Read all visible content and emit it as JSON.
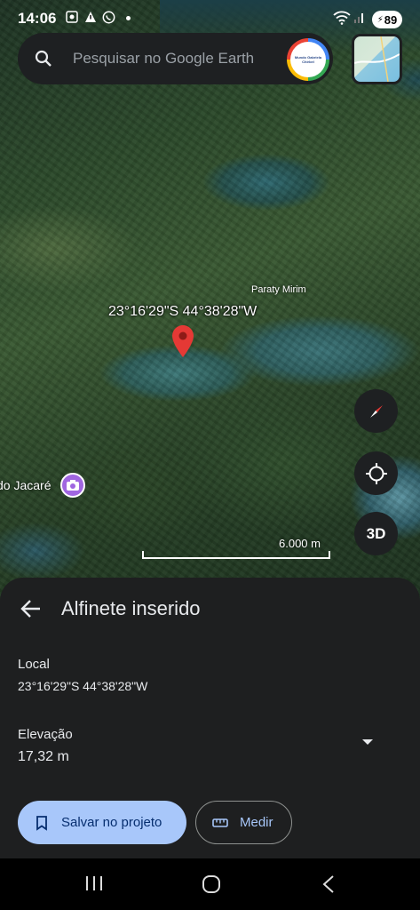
{
  "status": {
    "time": "14:06",
    "battery": "89",
    "icons": [
      "screenshot-icon",
      "warning-icon",
      "whatsapp-icon",
      "dot-icon",
      "wifi-icon",
      "signal-icon"
    ]
  },
  "search": {
    "placeholder": "Pesquisar no Google Earth",
    "avatar_text": "Mundo Gabriela Chirbel"
  },
  "map": {
    "coordinate_label": "23°16'29\"S 44°38'28\"W",
    "place_label": "Paraty Mirim",
    "poi_label": "do Jacaré",
    "scale_label": "6.000 m",
    "controls": {
      "three_d_label": "3D"
    }
  },
  "sheet": {
    "title": "Alfinete inserido",
    "location_label": "Local",
    "location_value": "23°16'29\"S 44°38'28\"W",
    "elevation_label": "Elevação",
    "elevation_value": "17,32 m",
    "save_label": "Salvar no projeto",
    "measure_label": "Medir"
  },
  "colors": {
    "sheet_bg": "#1e1f20",
    "primary_button": "#a8c7fa",
    "pin_red": "#e53935",
    "poi_purple": "#a066e0"
  }
}
